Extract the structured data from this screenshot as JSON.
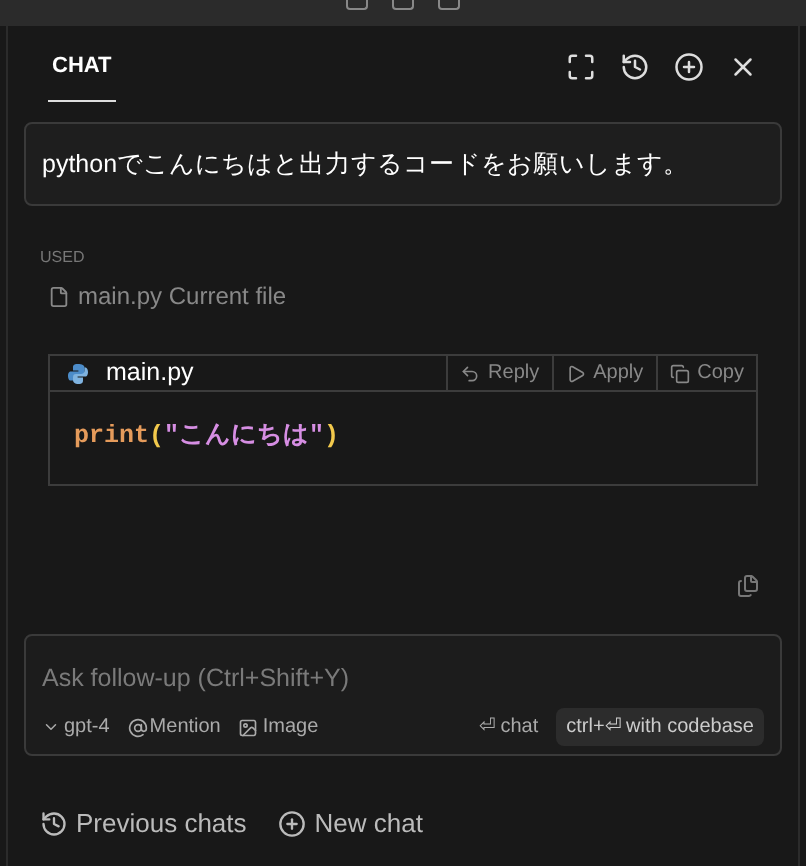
{
  "header": {
    "tab": {
      "label": "CHAT",
      "selected": true
    }
  },
  "user_message": "pythonでこんにちはと出力するコードをお願いします。",
  "context": {
    "heading": "USED",
    "file": "main.py",
    "note": "Current file"
  },
  "code_block": {
    "filename": "main.py",
    "actions": [
      "Reply",
      "Apply",
      "Copy"
    ],
    "tokens": [
      {
        "kind": "function",
        "text": "print"
      },
      {
        "kind": "bracket",
        "text": "("
      },
      {
        "kind": "string",
        "text": "\"こんにちは\""
      },
      {
        "kind": "bracket",
        "text": ")"
      }
    ]
  },
  "composer": {
    "placeholder": "Ask follow-up (Ctrl+Shift+Y)",
    "model": "gpt-4",
    "mention": "Mention",
    "image": "Image",
    "submit": "⏎ chat",
    "submit_codebase": "ctrl+⏎ with codebase"
  },
  "footer": {
    "previous": "Previous chats",
    "new": "New chat"
  }
}
